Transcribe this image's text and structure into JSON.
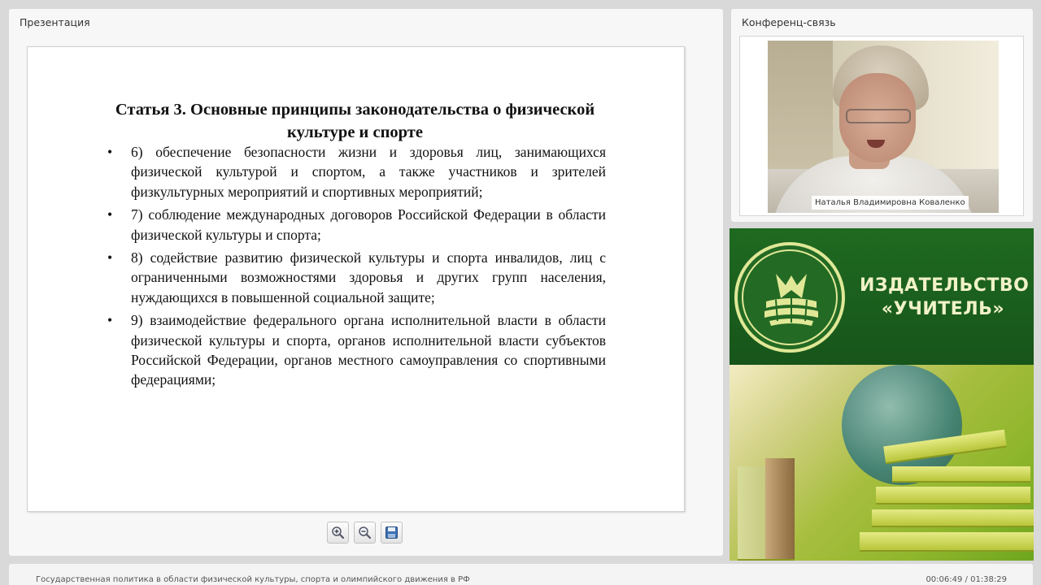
{
  "presentation": {
    "panel_title": "Презентация",
    "slide": {
      "title": "Статья 3. Основные принципы законодательства о физической культуре и спорте",
      "bullet": "•",
      "items": [
        "6) обеспечение безопасности жизни и здоровья лиц, занимающихся физической культурой и спортом, а также участников и зрителей физкультурных мероприятий и спортивных мероприятий;",
        "7) соблюдение международных договоров Российской Федерации в области физической культуры и спорта;",
        "8) содействие развитию физической культуры и спорта инвалидов, лиц с ограниченными возможностями здоровья и других групп населения, нуждающихся в повышенной социальной защите;",
        "9) взаимодействие федерального органа исполнительной власти в области физической культуры и спорта, органов исполнительной власти субъектов Российской Федерации, органов местного самоуправления со спортивными федерациями;"
      ]
    },
    "tools": {
      "zoom_in_icon": "zoom-in-icon",
      "zoom_out_icon": "zoom-out-icon",
      "save_icon": "save-icon"
    }
  },
  "conference": {
    "panel_title": "Конференц-связь",
    "speaker_name": "Наталья Владимировна Коваленко"
  },
  "advertisement": {
    "line1": "ИЗДАТЕЛЬСТВО",
    "line2": "«УЧИТЕЛЬ»",
    "colors": {
      "green": "#1f6a21",
      "text": "#f0f2c8"
    }
  },
  "footer": {
    "course_title": "Государственная политика в области физической культуры, спорта и олимпийского движения в РФ",
    "time": "00:06:49 / 01:38:29"
  }
}
